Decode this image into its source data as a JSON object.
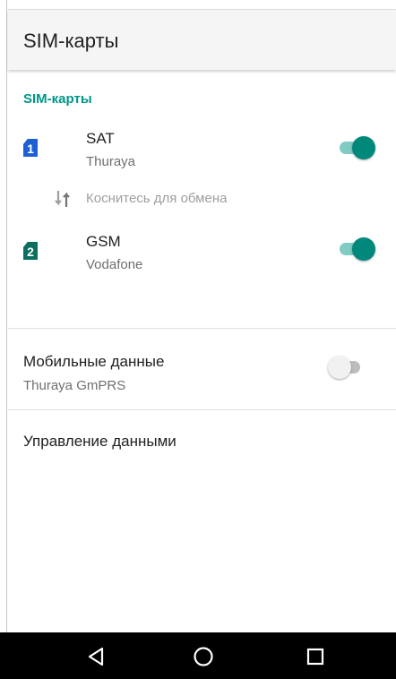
{
  "appbar": {
    "title": "SIM-карты"
  },
  "sims_section": {
    "header": "SIM-карты",
    "sims": [
      {
        "slot_number": "1",
        "name": "SAT",
        "operator": "Thuraya",
        "enabled": true,
        "badge_color": "#1e5fd6",
        "icon": "sim-card-1-icon"
      },
      {
        "slot_number": "2",
        "name": "GSM",
        "operator": "Vodafone",
        "enabled": true,
        "badge_color": "#0b6e5f",
        "icon": "sim-card-2-icon"
      }
    ],
    "swap": {
      "label": "Коснитесь для обмена",
      "icon": "swap-vert-icon"
    }
  },
  "mobile_data": {
    "title": "Мобильные данные",
    "subtitle": "Thuraya GmPRS",
    "enabled": false
  },
  "data_management": {
    "title": "Управление данными"
  },
  "navbar": {
    "buttons": [
      "back-icon",
      "home-icon",
      "recents-icon"
    ]
  },
  "colors": {
    "accent": "#009688",
    "switch_on_thumb": "#00897b",
    "switch_on_track": "#80cbc4"
  }
}
